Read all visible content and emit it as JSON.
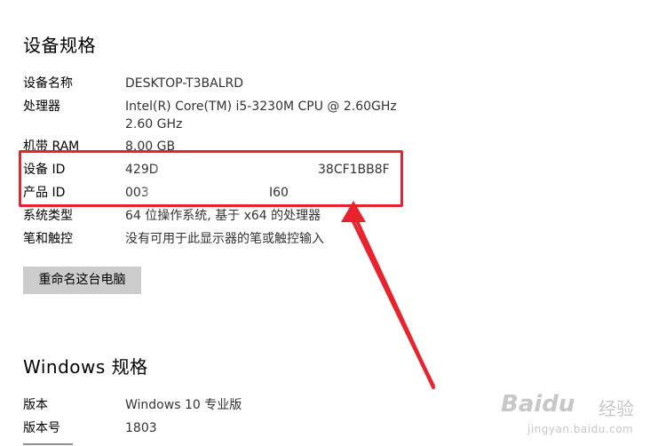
{
  "device_specs": {
    "title": "设备规格",
    "rows": [
      {
        "label": "设备名称",
        "value": "DESKTOP-T3BALRD"
      },
      {
        "label": "处理器",
        "value": "Intel(R) Core(TM) i5-3230M CPU @ 2.60GHz   2.60 GHz"
      },
      {
        "label": "机带 RAM",
        "value": "8.00 GB"
      },
      {
        "label": "设备 ID",
        "value_start": "429D",
        "value_end": "38CF1BB8F"
      },
      {
        "label": "产品 ID",
        "value_start": "003",
        "value_end": "I60"
      },
      {
        "label": "系统类型",
        "value": "64 位操作系统, 基于 x64 的处理器"
      },
      {
        "label": "笔和触控",
        "value": "没有可用于此显示器的笔或触控输入"
      }
    ],
    "rename_button": "重命名这台电脑"
  },
  "windows_specs": {
    "title": "Windows 规格",
    "rows": [
      {
        "label": "版本",
        "value": "Windows 10 专业版"
      },
      {
        "label": "版本号",
        "value": "1803"
      }
    ]
  },
  "colors": {
    "annotation_red": "#e8232d",
    "button_bg": "#cccccc"
  },
  "watermark": {
    "brand": "Baidu",
    "cn": "经验",
    "url": "jingyan.baidu.com"
  }
}
